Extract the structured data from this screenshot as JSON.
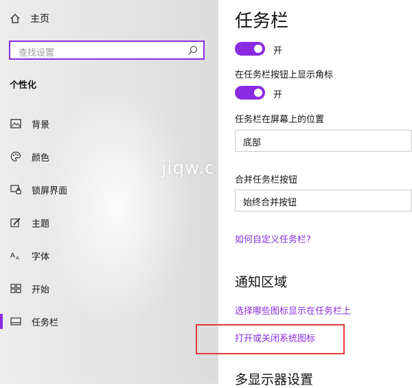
{
  "sidebar": {
    "home_label": "主页",
    "search_placeholder": "查找设置",
    "section_title": "个性化",
    "items": [
      {
        "label": "背景",
        "icon": "image-icon"
      },
      {
        "label": "颜色",
        "icon": "palette-icon"
      },
      {
        "label": "锁屏界面",
        "icon": "lock-screen-icon"
      },
      {
        "label": "主题",
        "icon": "theme-brush-icon"
      },
      {
        "label": "字体",
        "icon": "font-icon"
      },
      {
        "label": "开始",
        "icon": "start-menu-icon"
      },
      {
        "label": "任务栏",
        "icon": "taskbar-icon",
        "active": true
      }
    ]
  },
  "watermark": "jiqw.c",
  "main": {
    "title": "任务栏",
    "toggle1_state": "开",
    "badge_label": "在任务栏按钮上显示角标",
    "toggle2_state": "开",
    "position_label": "任务栏在屏幕上的位置",
    "position_value": "底部",
    "combine_label": "合并任务栏按钮",
    "combine_value": "始终合并按钮",
    "customize_link": "如何自定义任务栏?",
    "notification_heading": "通知区域",
    "select_icons_link": "选择哪些图标显示在任务栏上",
    "system_icons_link": "打开或关闭系统图标",
    "multi_display_heading": "多显示器设置"
  },
  "colors": {
    "accent": "#8a2be2",
    "highlight_border": "#e53935"
  }
}
